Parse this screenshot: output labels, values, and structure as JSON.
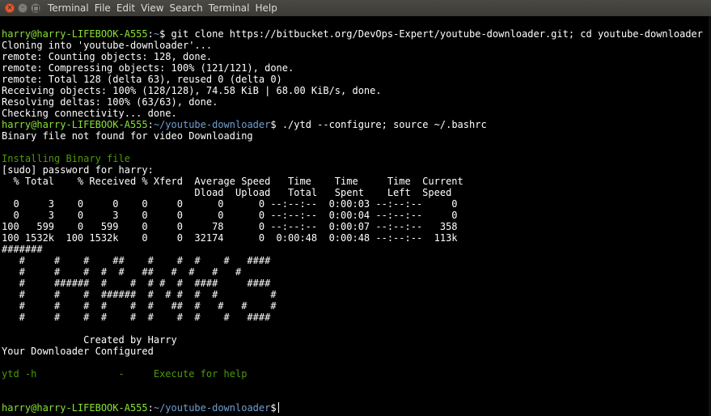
{
  "menubar": {
    "items": [
      "Terminal",
      "File",
      "Edit",
      "View",
      "Search",
      "Terminal",
      "Help"
    ]
  },
  "terminal": {
    "prompt": {
      "userhost": "harry@harry-LIFEBOOK-A555",
      "home": "~",
      "cwd": "~/youtube-downloader",
      "symbol": "$"
    },
    "cmd1": " git clone https://bitbucket.org/DevOps-Expert/youtube-downloader.git; cd youtube-downloader",
    "clone_output": [
      "Cloning into 'youtube-downloader'...",
      "remote: Counting objects: 128, done.",
      "remote: Compressing objects: 100% (121/121), done.",
      "remote: Total 128 (delta 63), reused 0 (delta 0)",
      "Receiving objects: 100% (128/128), 74.58 KiB | 68.00 KiB/s, done.",
      "Resolving deltas: 100% (63/63), done.",
      "Checking connectivity... done."
    ],
    "cmd2": " ./ytd --configure; source ~/.bashrc",
    "binary_msg": "Binary file not found for video Downloading",
    "installing": "Installing Binary file",
    "sudo_prompt": "[sudo] password for harry:",
    "curl_header": [
      "  % Total    % Received % Xferd  Average Speed   Time    Time     Time  Current",
      "                                 Dload  Upload   Total   Spent    Left  Speed"
    ],
    "curl_rows": [
      "  0     3    0     0    0     0      0      0 --:--:--  0:00:03 --:--:--     0",
      "  0     3    0     3    0     0      0      0 --:--:--  0:00:04 --:--:--     0",
      "100   599    0   599    0     0     78      0 --:--:--  0:00:07 --:--:--   358",
      "100 1532k  100 1532k    0     0  32174      0  0:00:48  0:00:48 --:--:--  113k"
    ],
    "hashes": "#######",
    "banner": [
      "   #     #    #    ##    #    #  #    #   ####",
      "   #     #    #  #  #   ##   #  #   #   #",
      "   #     ######  #    #  # #  #  ####     ####",
      "   #     #    #  ######  #  # #  #  #         #",
      "   #     #    #  #    #  #   ##  #   #   #    #",
      "   #     #    #  #    #  #    #  #    #   ####"
    ],
    "created_by": "              Created by Harry",
    "configured": "Your Downloader Configured",
    "help_line": "ytd -h              -     Execute for help"
  }
}
